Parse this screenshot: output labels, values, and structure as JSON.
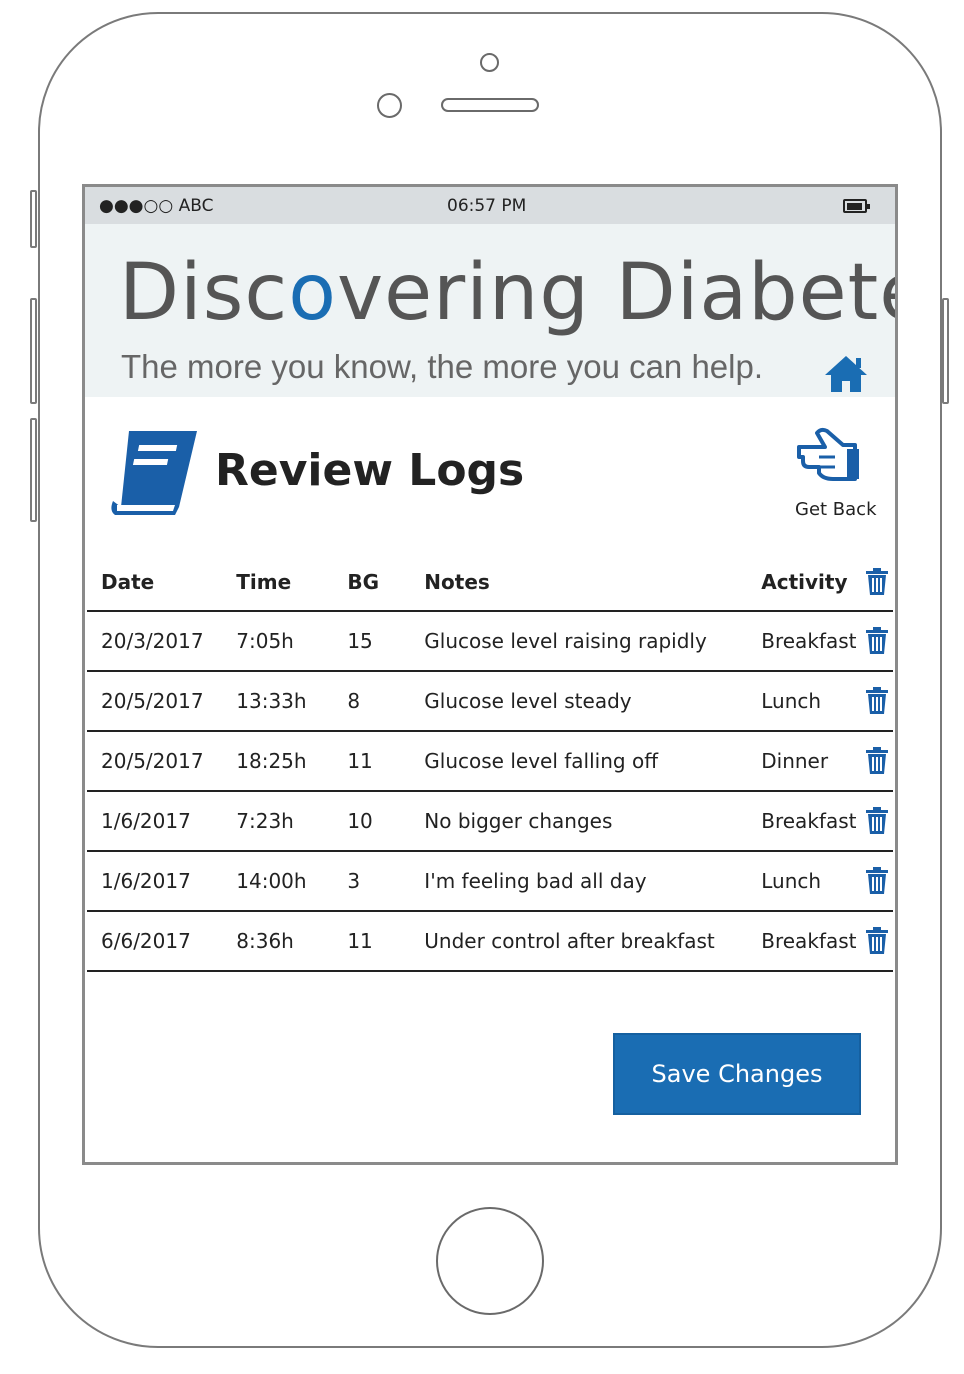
{
  "status_bar": {
    "carrier": "●●●○○ ABC",
    "time": "06:57 PM",
    "battery_icon": "battery-icon"
  },
  "banner": {
    "title_before": "Disc",
    "title_o": "o",
    "title_after": "vering Diabetes",
    "tagline": "The more you know, the more you can help.",
    "home_icon": "home-icon"
  },
  "page": {
    "title": "Review Logs",
    "title_icon": "book-icon",
    "back_label": "Get Back",
    "back_icon": "pointing-hand-icon"
  },
  "table": {
    "headers": {
      "date": "Date",
      "time": "Time",
      "bg": "BG",
      "notes": "Notes",
      "activity": "Activity"
    },
    "rows": [
      {
        "date": "20/3/2017",
        "time": "7:05h",
        "bg": "15",
        "notes": "Glucose level raising rapidly",
        "activity": "Breakfast"
      },
      {
        "date": "20/5/2017",
        "time": "13:33h",
        "bg": "8",
        "notes": "Glucose level steady",
        "activity": "Lunch"
      },
      {
        "date": "20/5/2017",
        "time": "18:25h",
        "bg": "11",
        "notes": "Glucose level falling off",
        "activity": "Dinner"
      },
      {
        "date": "1/6/2017",
        "time": "7:23h",
        "bg": "10",
        "notes": "No bigger changes",
        "activity": "Breakfast"
      },
      {
        "date": "1/6/2017",
        "time": "14:00h",
        "bg": "3",
        "notes": "I'm feeling bad all day",
        "activity": "Lunch"
      },
      {
        "date": "6/6/2017",
        "time": "8:36h",
        "bg": "11",
        "notes": "Under control after breakfast",
        "activity": "Breakfast"
      }
    ],
    "delete_icon": "trash-icon"
  },
  "save_button": {
    "label": "Save Changes"
  },
  "colors": {
    "accent": "#1a6db3",
    "banner_bg": "#eef3f4",
    "status_bg": "#d9dde0"
  }
}
